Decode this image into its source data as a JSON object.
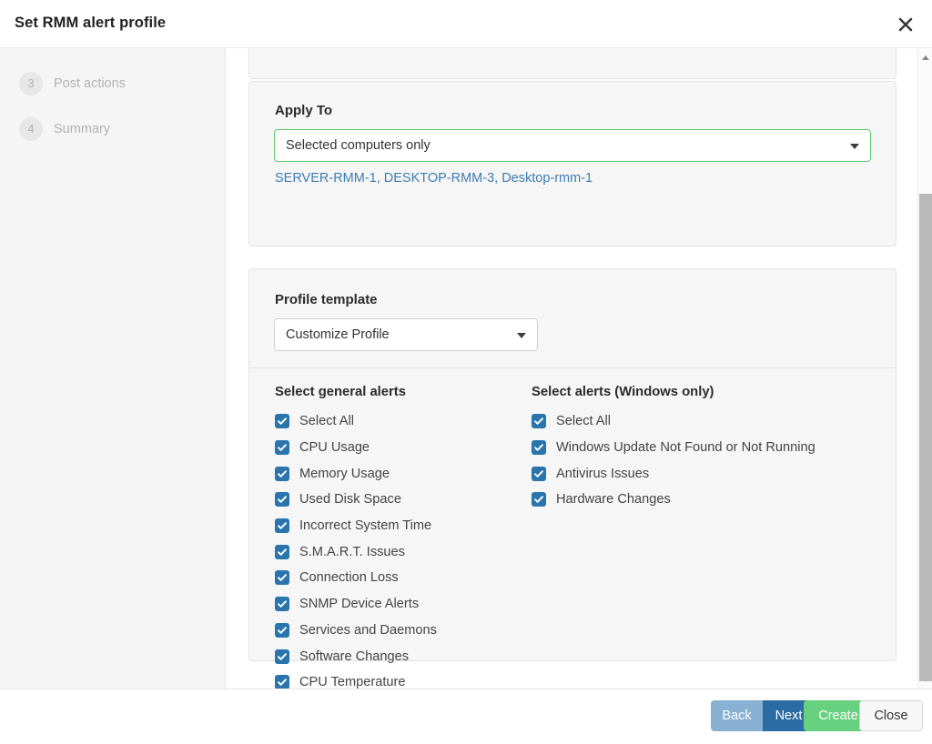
{
  "header": {
    "title": "Set RMM alert profile",
    "close_icon": "close-icon"
  },
  "sidebar": {
    "steps": [
      {
        "number": "3",
        "label": "Post actions"
      },
      {
        "number": "4",
        "label": "Summary"
      }
    ]
  },
  "apply_to": {
    "label": "Apply To",
    "select_value": "Selected computers only",
    "computers_text": "SERVER-RMM-1, DESKTOP-RMM-3, Desktop-rmm-1"
  },
  "profile": {
    "label": "Profile template",
    "select_value": "Customize Profile"
  },
  "general_alerts": {
    "title": "Select general alerts",
    "items": [
      {
        "label": "Select All",
        "checked": true
      },
      {
        "label": "CPU Usage",
        "checked": true
      },
      {
        "label": "Memory Usage",
        "checked": true
      },
      {
        "label": "Used Disk Space",
        "checked": true
      },
      {
        "label": "Incorrect System Time",
        "checked": true
      },
      {
        "label": "S.M.A.R.T. Issues",
        "checked": true
      },
      {
        "label": "Connection Loss",
        "checked": true
      },
      {
        "label": "SNMP Device Alerts",
        "checked": true
      },
      {
        "label": "Services and Daemons",
        "checked": true
      },
      {
        "label": "Software Changes",
        "checked": true
      },
      {
        "label": "CPU Temperature",
        "checked": true
      }
    ]
  },
  "windows_alerts": {
    "title": "Select alerts (Windows only)",
    "items": [
      {
        "label": "Select All",
        "checked": true
      },
      {
        "label": "Windows Update Not Found or Not Running",
        "checked": true
      },
      {
        "label": "Antivirus Issues",
        "checked": true
      },
      {
        "label": "Hardware Changes",
        "checked": true
      }
    ]
  },
  "footer": {
    "back_label": "Back",
    "next_label": "Next",
    "create_label": "Create",
    "close_label": "Close"
  },
  "colors": {
    "accent_green": "#5dc96e",
    "checkbox_blue": "#2a75ad",
    "link_blue": "#3e7cb1",
    "next_blue": "#2a6ca3",
    "back_blue": "#88b0d3",
    "create_green": "#68d17f"
  }
}
